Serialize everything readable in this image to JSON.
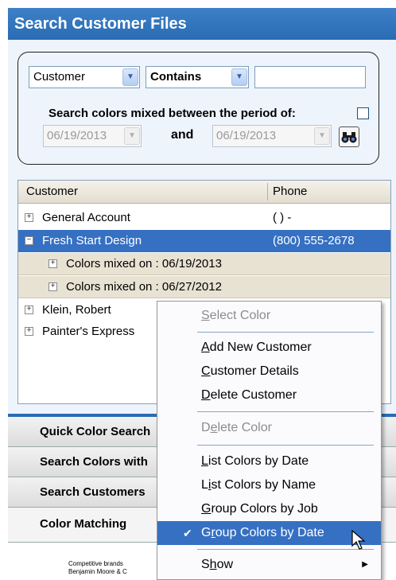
{
  "header": {
    "title": "Search Customer Files"
  },
  "search": {
    "field_value": "Customer",
    "operator_value": "Contains",
    "query_value": "",
    "period_label": "Search colors mixed between the period of:",
    "date_from": "06/19/2013",
    "and_label": "and",
    "date_to": "06/19/2013"
  },
  "tree": {
    "columns": {
      "customer": "Customer",
      "phone": "Phone"
    },
    "rows": [
      {
        "label": "General Account",
        "phone": "(  )  -"
      },
      {
        "label": "Fresh Start Design",
        "phone": "(800) 555-2678"
      },
      {
        "label": "Colors mixed on : 06/19/2013"
      },
      {
        "label": "Colors mixed on : 06/27/2012"
      },
      {
        "label": "Klein, Robert"
      },
      {
        "label": "Painter's Express"
      }
    ]
  },
  "sections": [
    {
      "label": "Quick Color Search"
    },
    {
      "label": "Search Colors with"
    },
    {
      "label": "Search Customers"
    },
    {
      "label": "Color Matching"
    }
  ],
  "fine_print": {
    "line1": "Competitive brands",
    "line2": "Benjamin Moore & C"
  },
  "context_menu": {
    "select_color": {
      "pre": "",
      "key": "S",
      "post": "elect Color"
    },
    "add_new_customer": {
      "pre": "",
      "key": "A",
      "post": "dd New Customer"
    },
    "customer_details": {
      "pre": "",
      "key": "C",
      "post": "ustomer Details"
    },
    "delete_customer": {
      "pre": "",
      "key": "D",
      "post": "elete Customer"
    },
    "delete_color": {
      "pre": "D",
      "key": "e",
      "post": "lete Color"
    },
    "list_by_date": {
      "pre": "",
      "key": "L",
      "post": "ist Colors by Date"
    },
    "list_by_name": {
      "pre": "L",
      "key": "i",
      "post": "st Colors by Name"
    },
    "group_by_job": {
      "pre": "",
      "key": "G",
      "post": "roup Colors by Job"
    },
    "group_by_date": {
      "pre": "G",
      "key": "r",
      "post": "oup Colors by Date"
    },
    "show": {
      "pre": "S",
      "key": "h",
      "post": "ow"
    }
  },
  "colors": {
    "accent": "#2a6cb3",
    "selection": "#3570c3"
  }
}
